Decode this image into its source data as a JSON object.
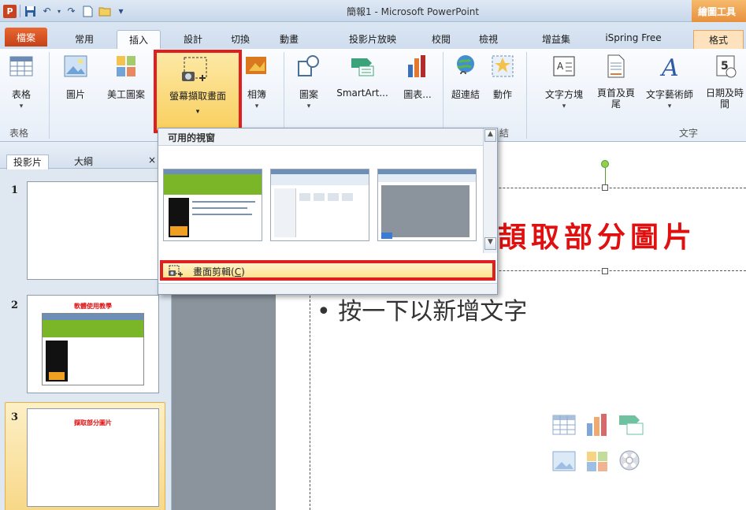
{
  "window": {
    "title": "簡報1 - Microsoft PowerPoint",
    "context_tab_title": "繪圖工具"
  },
  "quick_access": {
    "logo": "P",
    "undo": "↶",
    "redo": "↷",
    "more": "▾"
  },
  "tabs": [
    {
      "label": "檔案"
    },
    {
      "label": "常用"
    },
    {
      "label": "插入"
    },
    {
      "label": "設計"
    },
    {
      "label": "切換"
    },
    {
      "label": "動畫"
    },
    {
      "label": "投影片放映"
    },
    {
      "label": "校閱"
    },
    {
      "label": "檢視"
    },
    {
      "label": "增益集"
    },
    {
      "label": "iSpring Free"
    },
    {
      "label": "格式"
    }
  ],
  "ribbon": {
    "table": "表格",
    "picture": "圖片",
    "clipart": "美工圖案",
    "screenshot": "螢幕擷取畫面",
    "album": "相簿",
    "shapes": "圖案",
    "smartart": "SmartArt...",
    "chart": "圖表...",
    "hyperlink": "超連結",
    "action": "動作",
    "textbox": "文字方塊",
    "header_footer": "頁首及頁尾",
    "wordart": "文字藝術師",
    "datetime": "日期及時間",
    "group_table": "表格",
    "group_links_partial": "結",
    "group_text": "文字"
  },
  "dropdown": {
    "header": "可用的視窗",
    "clip_label": "畫面剪輯(",
    "clip_key": "C",
    "clip_close": ")"
  },
  "panel": {
    "tab_slides": "投影片",
    "tab_outline": "大綱",
    "close": "×"
  },
  "thumbnails": [
    {
      "num": "1",
      "title": ""
    },
    {
      "num": "2",
      "title": "軟體使用教學"
    },
    {
      "num": "3",
      "title": "擷取部分圖片"
    }
  ],
  "slide": {
    "title": "擷取部分圖片",
    "title_visible": "頡取部分圖片",
    "body": "• 按一下以新增文字"
  },
  "colors": {
    "accent_red": "#e02020",
    "title_red": "#e01010",
    "file_tab": "#c4421a",
    "highlight_yellow": "#f9cf5f"
  }
}
